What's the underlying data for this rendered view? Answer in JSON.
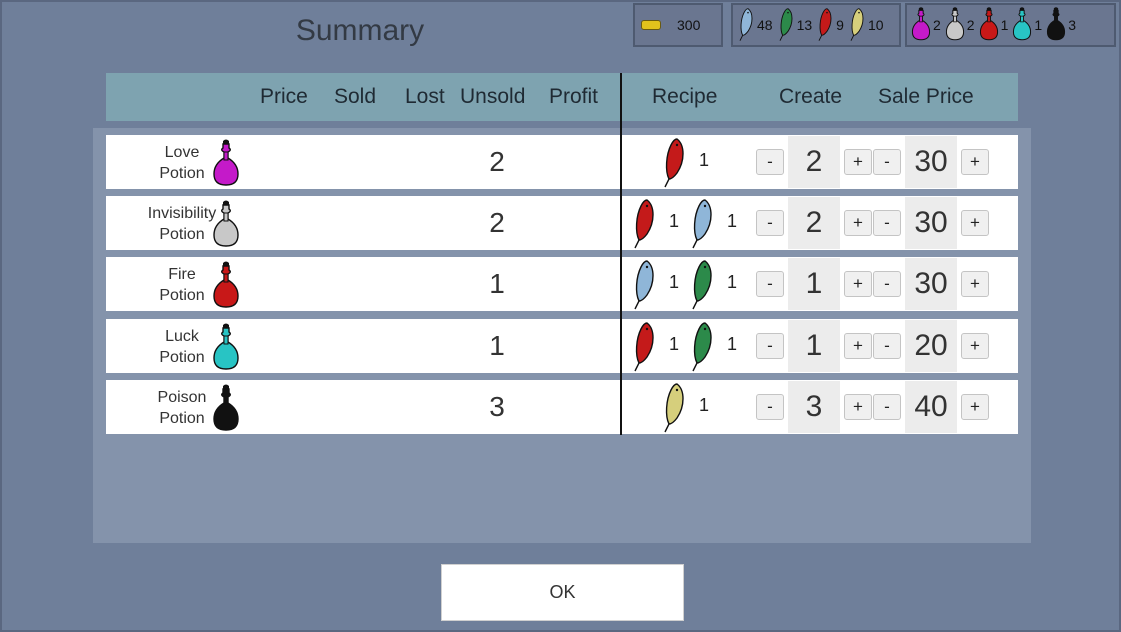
{
  "title": "Summary",
  "resources": {
    "gold": "300",
    "herbs": [
      {
        "icon": "blue-leaf-icon",
        "color": "#8fb6d8",
        "count": "48"
      },
      {
        "icon": "green-leaf-icon",
        "color": "#2c8a4a",
        "count": "13"
      },
      {
        "icon": "red-leaf-icon",
        "color": "#c41a1a",
        "count": "9"
      },
      {
        "icon": "yellow-leaf-icon",
        "color": "#d6cf7c",
        "count": "10"
      }
    ],
    "potions": [
      {
        "icon": "love-potion-icon",
        "color": "#c41ac9",
        "count": "2"
      },
      {
        "icon": "invisibility-potion-icon",
        "color": "#c8c8c8",
        "count": "2"
      },
      {
        "icon": "fire-potion-icon",
        "color": "#c81818",
        "count": "1"
      },
      {
        "icon": "luck-potion-icon",
        "color": "#28c4c4",
        "count": "1"
      },
      {
        "icon": "poison-potion-icon",
        "color": "#111111",
        "count": "3"
      }
    ]
  },
  "headers": {
    "price": "Price",
    "sold": "Sold",
    "lost": "Lost",
    "unsold": "Unsold",
    "profit": "Profit",
    "recipe": "Recipe",
    "create": "Create",
    "sale_price": "Sale Price"
  },
  "rows": [
    {
      "name1": "Love",
      "name2": "Potion",
      "color": "#c41ac9",
      "unsold": "2",
      "recipe": [
        {
          "color": "#c41a1a",
          "count": "1"
        }
      ],
      "create": "2",
      "sale_price": "30"
    },
    {
      "name1": "Invisibility",
      "name2": "Potion",
      "color": "#c8c8c8",
      "unsold": "2",
      "recipe": [
        {
          "color": "#c41a1a",
          "count": "1"
        },
        {
          "color": "#8fb6d8",
          "count": "1"
        }
      ],
      "create": "2",
      "sale_price": "30"
    },
    {
      "name1": "Fire",
      "name2": "Potion",
      "color": "#c81818",
      "unsold": "1",
      "recipe": [
        {
          "color": "#8fb6d8",
          "count": "1"
        },
        {
          "color": "#2c8a4a",
          "count": "1"
        }
      ],
      "create": "1",
      "sale_price": "30"
    },
    {
      "name1": "Luck",
      "name2": "Potion",
      "color": "#28c4c4",
      "unsold": "1",
      "recipe": [
        {
          "color": "#c41a1a",
          "count": "1"
        },
        {
          "color": "#2c8a4a",
          "count": "1"
        }
      ],
      "create": "1",
      "sale_price": "20"
    },
    {
      "name1": "Poison",
      "name2": "Potion",
      "color": "#111111",
      "unsold": "3",
      "recipe": [
        {
          "color": "#d6cf7c",
          "count": "1"
        }
      ],
      "create": "3",
      "sale_price": "40"
    }
  ],
  "buttons": {
    "minus": "-",
    "plus": "+",
    "ok": "OK"
  }
}
